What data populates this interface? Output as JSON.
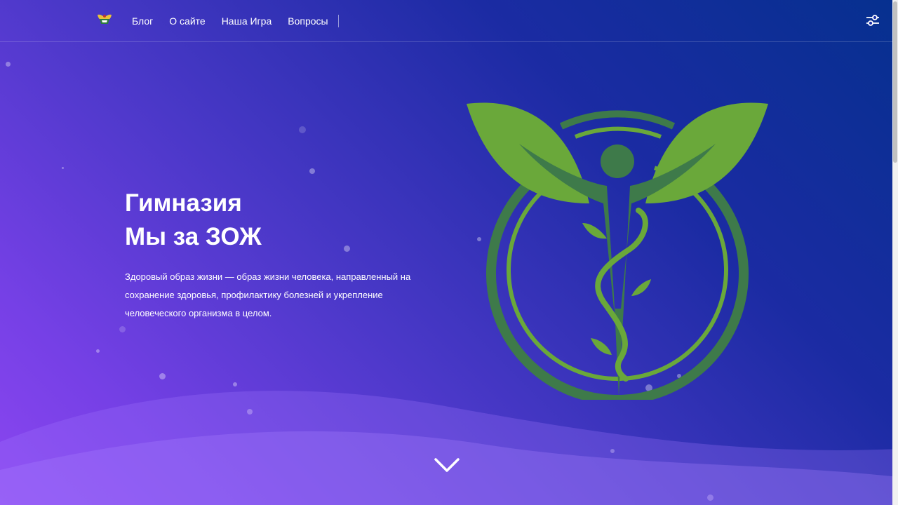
{
  "nav": {
    "logo_icon": "school-crest-icon",
    "links": [
      "Блог",
      "О сайте",
      "Наша Игра",
      "Вопросы"
    ],
    "settings_icon": "sliders-icon"
  },
  "hero": {
    "title_line1": "Гимназия",
    "title_line2": "Мы за ЗОЖ",
    "description": "Здоровый образ жизни — образ жизни человека, направленный на сохранение здоровья, профилактику болезней и укрепление человеческого организма в целом.",
    "emblem_icon": "healthy-lifestyle-emblem-icon",
    "scroll_icon": "chevron-down-icon"
  },
  "colors": {
    "leaf_light": "#6aa83a",
    "leaf_dark": "#3e7a4a",
    "background_top": "#06308f",
    "background_bottom": "#8b46f0"
  }
}
